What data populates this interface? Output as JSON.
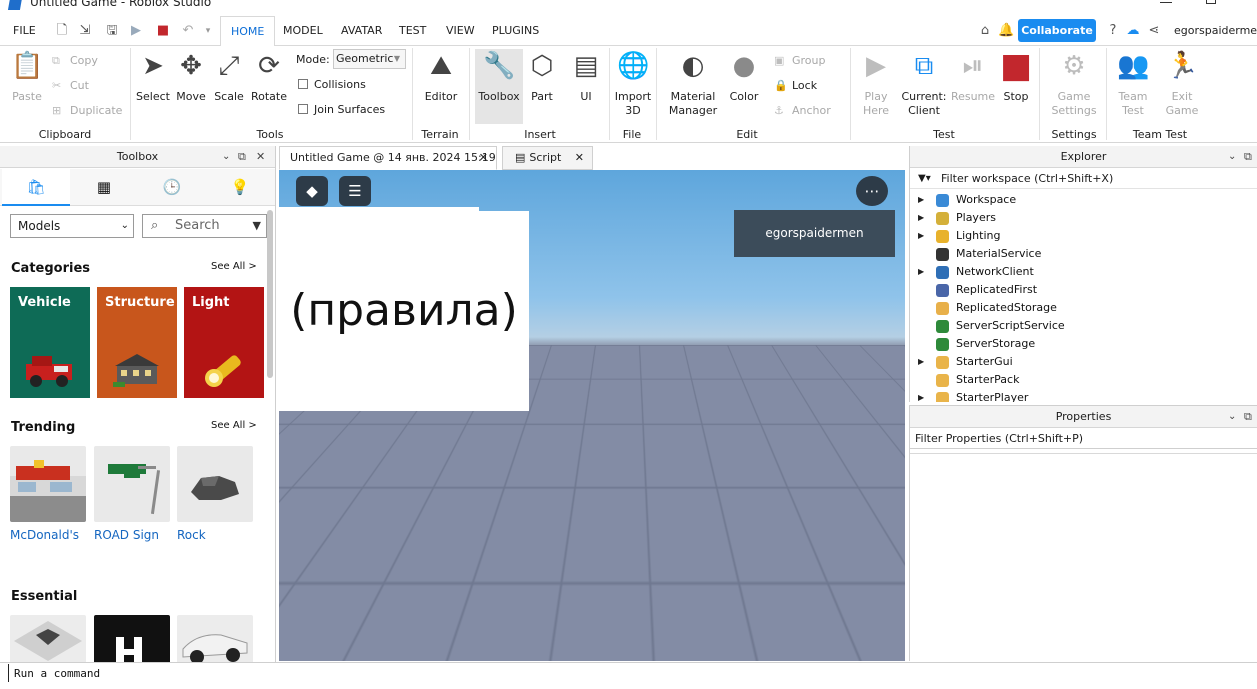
{
  "window": {
    "title": "Untitled Game - Roblox Studio"
  },
  "menu": {
    "tabs": [
      "FILE",
      "HOME",
      "MODEL",
      "AVATAR",
      "TEST",
      "VIEW",
      "PLUGINS"
    ],
    "active_tab": "HOME",
    "collaborate_label": "Collaborate",
    "username": "egorspaidermen"
  },
  "ribbon": {
    "clipboard": {
      "paste": "Paste",
      "copy": "Copy",
      "cut": "Cut",
      "duplicate": "Duplicate",
      "group_label": "Clipboard"
    },
    "tools": {
      "select": "Select",
      "move": "Move",
      "scale": "Scale",
      "rotate": "Rotate",
      "mode_label": "Mode:",
      "mode_value": "Geometric",
      "collisions": "Collisions",
      "join_surfaces": "Join Surfaces",
      "group_label": "Tools"
    },
    "terrain": {
      "editor": "Editor",
      "group_label": "Terrain"
    },
    "insert": {
      "toolbox": "Toolbox",
      "part": "Part",
      "ui": "UI",
      "group_label": "Insert"
    },
    "file": {
      "import3d": "Import\n3D",
      "group_label": "File"
    },
    "edit": {
      "material_manager": "Material\nManager",
      "color": "Color",
      "group": "Group",
      "lock": "Lock",
      "anchor": "Anchor",
      "group_label": "Edit"
    },
    "test": {
      "play_here": "Play\nHere",
      "current_client": "Current:\nClient",
      "resume": "Resume",
      "stop": "Stop",
      "group_label": "Test"
    },
    "settings": {
      "game_settings": "Game\nSettings",
      "group_label": "Settings"
    },
    "team_test": {
      "team_test": "Team\nTest",
      "exit_game": "Exit\nGame",
      "group_label": "Team Test"
    }
  },
  "toolbox": {
    "title": "Toolbox",
    "category_select": "Models",
    "search_placeholder": "Search",
    "categories_title": "Categories",
    "categories_see_all": "See All >",
    "categories": [
      "Vehicle",
      "Structure",
      "Light"
    ],
    "trending_title": "Trending",
    "trending_see_all": "See All >",
    "trending": [
      "McDonald's",
      "ROAD Sign",
      "Rock"
    ],
    "essential_title": "Essential"
  },
  "doc_tabs": [
    {
      "label": "Untitled Game @ 14 янв. 2024 15:19"
    },
    {
      "label": "Script"
    }
  ],
  "viewport": {
    "player_name": "egorspaidermen",
    "rules_text": "(правила)"
  },
  "explorer": {
    "title": "Explorer",
    "filter_placeholder": "Filter workspace (Ctrl+Shift+X)",
    "items": [
      {
        "label": "Workspace",
        "expandable": true,
        "color": "#3a8ad6"
      },
      {
        "label": "Players",
        "expandable": true,
        "color": "#d4b03a"
      },
      {
        "label": "Lighting",
        "expandable": true,
        "color": "#e8b22c"
      },
      {
        "label": "MaterialService",
        "expandable": false,
        "color": "#333333"
      },
      {
        "label": "NetworkClient",
        "expandable": true,
        "color": "#2f6fb6"
      },
      {
        "label": "ReplicatedFirst",
        "expandable": false,
        "color": "#4a66a8"
      },
      {
        "label": "ReplicatedStorage",
        "expandable": false,
        "color": "#e8b04a"
      },
      {
        "label": "ServerScriptService",
        "expandable": false,
        "color": "#2e8a3a"
      },
      {
        "label": "ServerStorage",
        "expandable": false,
        "color": "#2e8a3a"
      },
      {
        "label": "StarterGui",
        "expandable": true,
        "color": "#e9b44a"
      },
      {
        "label": "StarterPack",
        "expandable": false,
        "color": "#e9b44a"
      },
      {
        "label": "StarterPlayer",
        "expandable": true,
        "color": "#e9b44a"
      }
    ]
  },
  "properties": {
    "title": "Properties",
    "filter_placeholder": "Filter Properties (Ctrl+Shift+P)"
  },
  "command_bar": {
    "placeholder": "Run a command"
  }
}
